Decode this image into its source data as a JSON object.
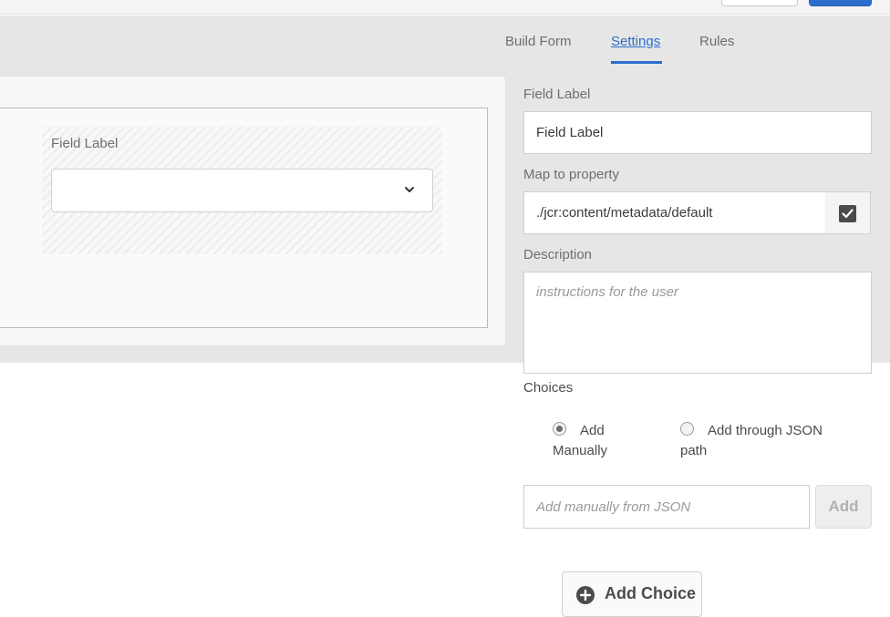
{
  "tabs": [
    {
      "label": "Build Form",
      "active": false
    },
    {
      "label": "Settings",
      "active": true
    },
    {
      "label": "Rules",
      "active": false
    }
  ],
  "canvas": {
    "field_label": "Field Label",
    "dropdown_value": ""
  },
  "settings": {
    "field_label": {
      "label": "Field Label",
      "value": "Field Label"
    },
    "map_to_property": {
      "label": "Map to property",
      "value": "./jcr:content/metadata/default",
      "checked": true
    },
    "description": {
      "label": "Description",
      "placeholder": "instructions for the user",
      "value": ""
    },
    "choices": {
      "label": "Choices",
      "options": [
        {
          "line1": "Add",
          "line2": "Manually",
          "selected": true
        },
        {
          "line1": "Add through JSON",
          "line2": "path",
          "selected": false
        }
      ],
      "json_input_placeholder": "Add manually from JSON",
      "add_button_label": "Add",
      "add_choice_label": "Add Choice"
    }
  },
  "colors": {
    "accent": "#2c6ecb",
    "workspace_bg": "#e6e6e6"
  }
}
